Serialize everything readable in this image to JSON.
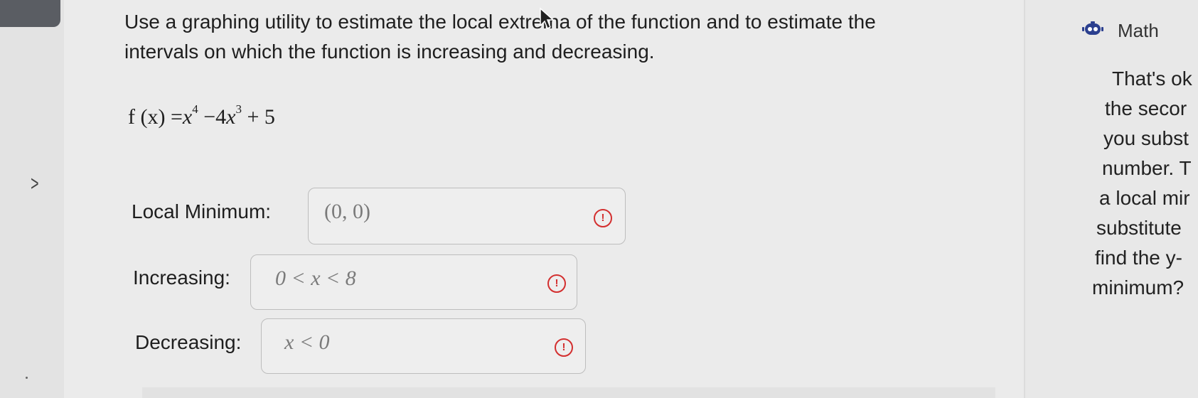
{
  "question": {
    "line1": "Use a graphing utility to estimate the local extrema of the function and to estimate the",
    "line2": "intervals on which the function is increasing and decreasing."
  },
  "formula": {
    "lhs": "f (x) =",
    "term1_base": "x",
    "term1_exp": "4",
    "term2_coef": "−4",
    "term2_base": "x",
    "term2_exp": "3",
    "term3": "+ 5"
  },
  "fields": {
    "local_minimum": {
      "label": "Local Minimum:",
      "value": "(0, 0)"
    },
    "increasing": {
      "label": "Increasing:",
      "value": "0 < x < 8"
    },
    "decreasing": {
      "label": "Decreasing:",
      "value": "x < 0"
    }
  },
  "alert_icon": {
    "name": "error-alert-icon",
    "glyph": "!",
    "color": "#d32f2f"
  },
  "side_panel": {
    "header": "Math",
    "lines": [
      "That's ok",
      "the secor",
      "you subst",
      "number. T",
      "a local mir",
      "substitute",
      "find the y-",
      "minimum?"
    ]
  },
  "expand_glyph": ">"
}
